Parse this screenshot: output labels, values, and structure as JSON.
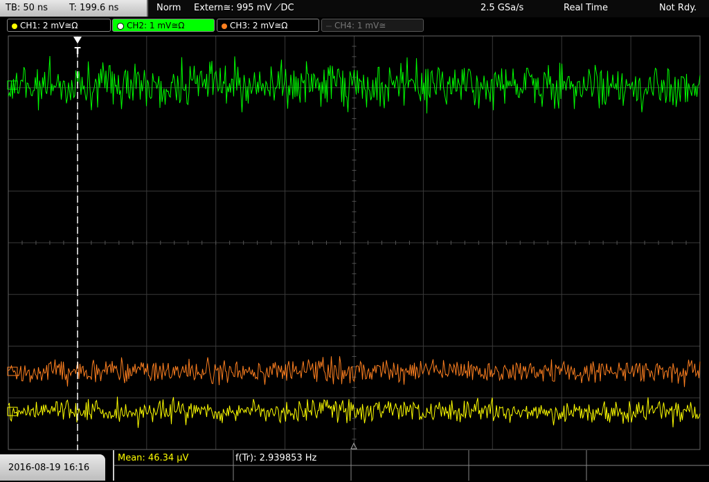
{
  "header": {
    "timebase": "TB: 50 ns",
    "trigger_time": "T: 199.6 ns",
    "mode": "Norm",
    "trigger_source": "Extern≅: 995 mV ⟋DC",
    "sample_rate": "2.5 GSa/s",
    "acq_mode": "Real Time",
    "state": "Not Rdy."
  },
  "channels": [
    {
      "label": "CH1: 2 mV≅Ω",
      "color": "#ffff00",
      "active": false,
      "enabled": true
    },
    {
      "label": "CH2: 1 mV≅Ω",
      "color": "#00ff00",
      "active": true,
      "enabled": true
    },
    {
      "label": "CH3: 2 mV≅Ω",
      "color": "#ff8020",
      "active": false,
      "enabled": true
    },
    {
      "label": "CH4: 1 mV≅",
      "color": "#777777",
      "active": false,
      "enabled": false
    }
  ],
  "trigger_marker": "T",
  "measurements": {
    "mean": "Mean: 46.34 µV",
    "frequency": "f(Tr): 2.939853 Hz"
  },
  "datetime": "2016-08-19 16:16",
  "colors": {
    "grid": "#3a3a3a",
    "ch1": "#ffff00",
    "ch2": "#00ff00",
    "ch3": "#ff8020"
  }
}
